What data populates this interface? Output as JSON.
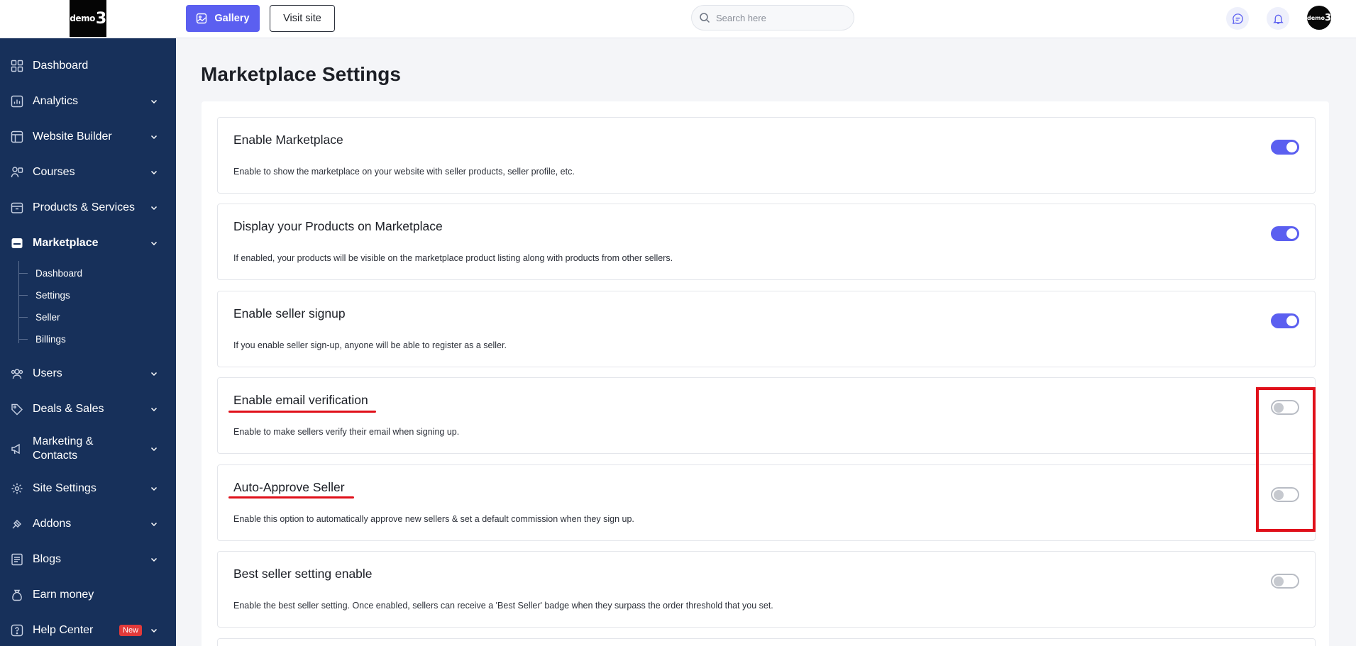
{
  "brand": {
    "logo_text": "demo",
    "logo_digit": "3"
  },
  "sidebar": {
    "items": [
      {
        "label": "Dashboard",
        "icon": "dashboard-grid-icon",
        "has_chevron": false
      },
      {
        "label": "Analytics",
        "icon": "analytics-icon",
        "has_chevron": true
      },
      {
        "label": "Website Builder",
        "icon": "website-builder-icon",
        "has_chevron": true
      },
      {
        "label": "Courses",
        "icon": "courses-icon",
        "has_chevron": true
      },
      {
        "label": "Products & Services",
        "icon": "products-box-icon",
        "has_chevron": true
      },
      {
        "label": "Marketplace",
        "icon": "marketplace-store-icon",
        "has_chevron": true,
        "active": true
      },
      {
        "label": "Users",
        "icon": "users-icon",
        "has_chevron": true
      },
      {
        "label": "Deals & Sales",
        "icon": "tag-icon",
        "has_chevron": true
      },
      {
        "label": "Marketing & Contacts",
        "icon": "megaphone-icon",
        "has_chevron": true
      },
      {
        "label": "Site Settings",
        "icon": "gear-icon",
        "has_chevron": true
      },
      {
        "label": "Addons",
        "icon": "addons-icon",
        "has_chevron": true
      },
      {
        "label": "Blogs",
        "icon": "blogs-icon",
        "has_chevron": true
      },
      {
        "label": "Earn money",
        "icon": "money-bag-icon",
        "has_chevron": false
      },
      {
        "label": "Help Center",
        "icon": "help-icon",
        "has_chevron": true,
        "badge": "New"
      }
    ],
    "marketplace_sub": [
      {
        "label": "Dashboard"
      },
      {
        "label": "Settings"
      },
      {
        "label": "Seller"
      },
      {
        "label": "Billings"
      }
    ]
  },
  "topbar": {
    "gallery_label": "Gallery",
    "visit_site_label": "Visit site",
    "search_placeholder": "Search here",
    "avatar_text": "demo",
    "avatar_digit": "3"
  },
  "page": {
    "title": "Marketplace Settings"
  },
  "settings": [
    {
      "title": "Enable Marketplace",
      "description": "Enable to show the marketplace on your website with seller products, seller profile, etc.",
      "enabled": true
    },
    {
      "title": "Display your Products on Marketplace",
      "description": "If enabled, your products will be visible on the marketplace product listing along with products from other sellers.",
      "enabled": true
    },
    {
      "title": "Enable seller signup",
      "description": "If you enable seller sign-up, anyone will be able to register as a seller.",
      "enabled": true
    },
    {
      "title": "Enable email verification",
      "description": "Enable to make sellers verify their email when signing up.",
      "enabled": false
    },
    {
      "title": "Auto-Approve Seller",
      "description": "Enable this option to automatically approve new sellers & set a default commission when they sign up.",
      "enabled": false
    },
    {
      "title": "Best seller setting enable",
      "description": "Enable the best seller setting. Once enabled, sellers can receive a 'Best Seller' badge when they surpass the order threshold that you set.",
      "enabled": false
    }
  ],
  "colors": {
    "sidebar_bg": "#17305a",
    "accent": "#5b5ff0",
    "highlight": "#e0101a"
  }
}
